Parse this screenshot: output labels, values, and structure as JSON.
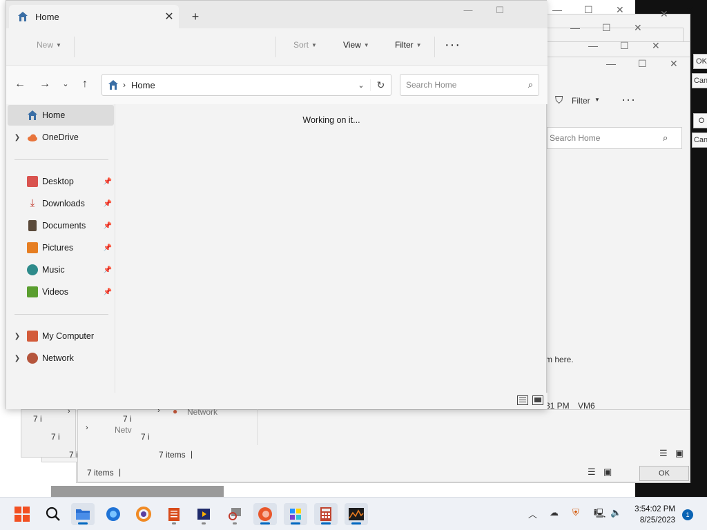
{
  "window": {
    "tab_title": "Home",
    "toolbar": {
      "new": "New",
      "sort": "Sort",
      "view": "View",
      "filter": "Filter"
    },
    "address": {
      "crumb": "Home"
    },
    "search": {
      "placeholder": "Search Home"
    },
    "sidebar": {
      "home": "Home",
      "onedrive": "OneDrive",
      "quick": [
        {
          "label": "Desktop",
          "icon": "desktop-folder-icon"
        },
        {
          "label": "Downloads",
          "icon": "downloads-icon"
        },
        {
          "label": "Documents",
          "icon": "documents-icon"
        },
        {
          "label": "Pictures",
          "icon": "pictures-icon"
        },
        {
          "label": "Music",
          "icon": "music-icon"
        },
        {
          "label": "Videos",
          "icon": "videos-icon"
        }
      ],
      "my_computer": "My Computer",
      "network": "Network"
    },
    "content": {
      "status": "Working on it..."
    }
  },
  "background": {
    "filter": "Filter",
    "search_placeholder": "Search Home",
    "network": "Network",
    "items_a": "7 items",
    "items_b": "7 items",
    "time_fragment": "31 PM",
    "vm": "VM6",
    "drop_text": "m here.",
    "ok": "OK",
    "ok_frag": "OK",
    "cancel_frag": "Can",
    "ok_frag2": "O",
    "cancel_frag2": "Can",
    "seven_frag": "7 i",
    "netw_frag": "Netv"
  },
  "taskbar": {
    "time": "3:54:02 PM",
    "date": "8/25/2023",
    "notifications": "1"
  },
  "colors": {
    "accent": "#0067c0",
    "window_bg": "#f3f3f3",
    "selected": "#dcdcdc"
  }
}
